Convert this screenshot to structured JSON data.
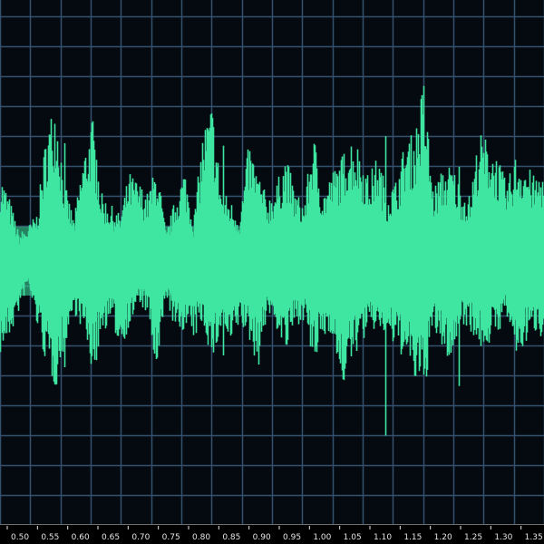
{
  "colors": {
    "background": "#050a10",
    "grid": "#34506e",
    "waveform": "#3ee6a2",
    "ruler_background": "#000000",
    "ruler_text": "#e6e6e6"
  },
  "waveform": {
    "type": "audio-waveform",
    "grid": true,
    "amplitude_range": [
      -1,
      1
    ],
    "peaks": [
      [
        0.38,
        -0.4
      ],
      [
        0.27,
        -0.33
      ],
      [
        0.12,
        -0.22
      ],
      [
        0.15,
        -0.1
      ],
      [
        0.21,
        -0.28
      ],
      [
        0.56,
        -0.45
      ],
      [
        0.71,
        -0.55
      ],
      [
        0.33,
        -0.36
      ],
      [
        0.18,
        -0.22
      ],
      [
        0.45,
        -0.3
      ],
      [
        0.62,
        -0.48
      ],
      [
        0.29,
        -0.31
      ],
      [
        0.24,
        -0.26
      ],
      [
        0.2,
        -0.37
      ],
      [
        0.38,
        -0.29
      ],
      [
        0.34,
        -0.18
      ],
      [
        0.29,
        -0.23
      ],
      [
        0.42,
        -0.52
      ],
      [
        0.12,
        -0.14
      ],
      [
        0.27,
        -0.32
      ],
      [
        0.4,
        -0.29
      ],
      [
        0.18,
        -0.34
      ],
      [
        0.56,
        -0.26
      ],
      [
        0.68,
        -0.44
      ],
      [
        0.31,
        -0.3
      ],
      [
        0.26,
        -0.38
      ],
      [
        0.19,
        -0.27
      ],
      [
        0.51,
        -0.34
      ],
      [
        0.38,
        -0.46
      ],
      [
        0.27,
        -0.22
      ],
      [
        0.33,
        -0.29
      ],
      [
        0.46,
        -0.4
      ],
      [
        0.3,
        -0.28
      ],
      [
        0.25,
        -0.25
      ],
      [
        0.56,
        -0.46
      ],
      [
        0.29,
        -0.34
      ],
      [
        0.38,
        -0.3
      ],
      [
        0.44,
        -0.56
      ],
      [
        0.54,
        -0.45
      ],
      [
        0.49,
        -0.36
      ],
      [
        0.36,
        -0.31
      ],
      [
        0.46,
        -0.29
      ],
      [
        0.3,
        -0.33
      ],
      [
        0.35,
        -0.38
      ],
      [
        0.52,
        -0.42
      ],
      [
        0.55,
        -0.52
      ],
      [
        0.78,
        -0.58
      ],
      [
        0.31,
        -0.3
      ],
      [
        0.39,
        -0.38
      ],
      [
        0.42,
        -0.44
      ],
      [
        0.32,
        -0.26
      ],
      [
        0.28,
        -0.29
      ],
      [
        0.55,
        -0.38
      ],
      [
        0.52,
        -0.36
      ],
      [
        0.45,
        -0.31
      ],
      [
        0.33,
        -0.24
      ],
      [
        0.46,
        -0.42
      ],
      [
        0.43,
        -0.36
      ],
      [
        0.36,
        -0.3
      ],
      [
        0.4,
        -0.33
      ]
    ]
  },
  "ruler": {
    "labels": [
      "0.50",
      "0.55",
      "0.60",
      "0.65",
      "0.70",
      "0.75",
      "0.80",
      "0.85",
      "0.90",
      "0.95",
      "1.00",
      "1.05",
      "1.10",
      "1.15",
      "1.20",
      "1.25",
      "1.30",
      "1.35"
    ]
  }
}
